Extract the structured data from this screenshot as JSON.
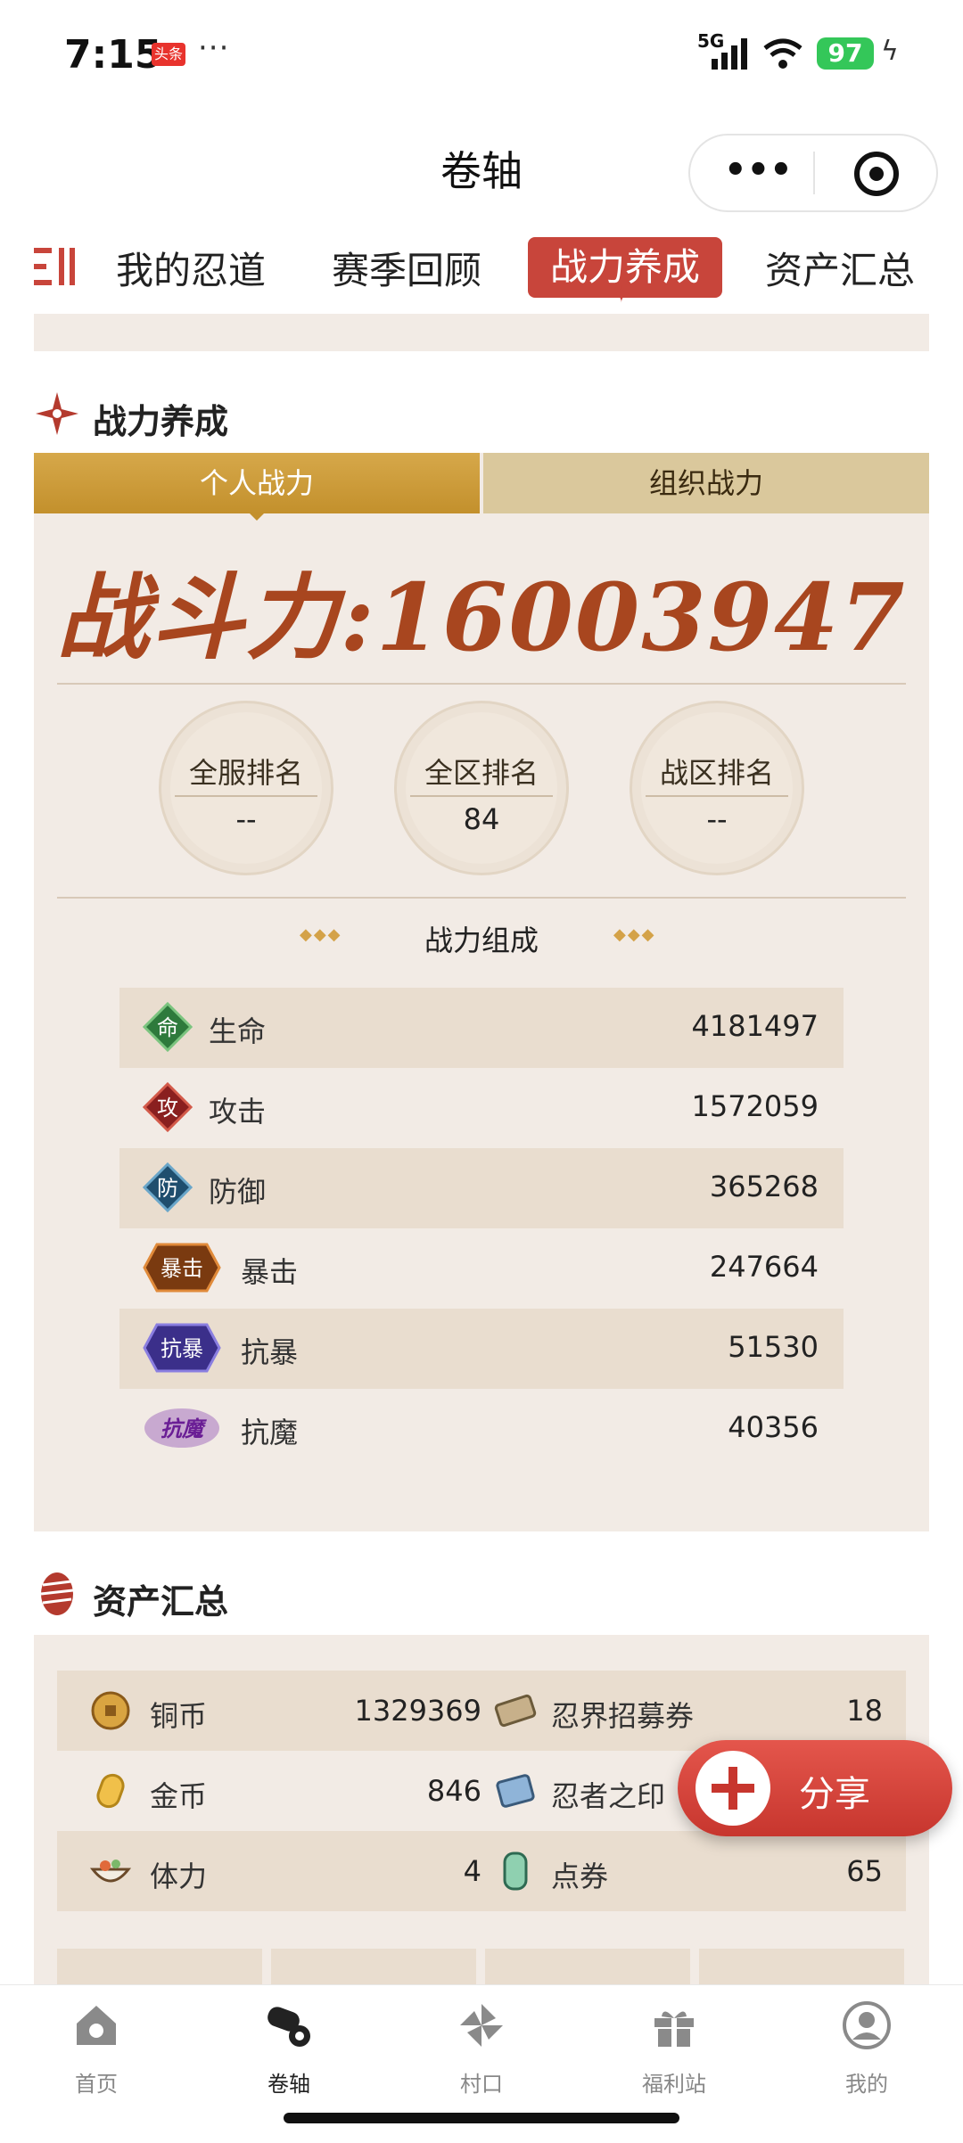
{
  "status_bar": {
    "time": "7:15",
    "badge": "头条",
    "dots": "···",
    "network": "5G",
    "battery": "97"
  },
  "header": {
    "title": "卷轴",
    "more_icon": "•••",
    "target_icon": "target-icon"
  },
  "tabs": [
    {
      "label": "我的忍道"
    },
    {
      "label": "赛季回顾"
    },
    {
      "label": "战力养成"
    },
    {
      "label": "资产汇总"
    }
  ],
  "power_section": {
    "title": "战力养成",
    "segments": {
      "personal": "个人战力",
      "org": "组织战力"
    },
    "power_text": "战斗力:16003947",
    "ranks": [
      {
        "label": "全服排名",
        "value": "--"
      },
      {
        "label": "全区排名",
        "value": "84"
      },
      {
        "label": "战区排名",
        "value": "--"
      }
    ],
    "composition_title": "战力组成",
    "stats": [
      {
        "icon_text": "命",
        "label": "生命",
        "value": "4181497"
      },
      {
        "icon_text": "攻",
        "label": "攻击",
        "value": "1572059"
      },
      {
        "icon_text": "防",
        "label": "防御",
        "value": "365268"
      },
      {
        "icon_text": "暴击",
        "label": "暴击",
        "value": "247664"
      },
      {
        "icon_text": "抗暴",
        "label": "抗暴",
        "value": "51530"
      },
      {
        "icon_text": "抗魔",
        "label": "抗魔",
        "value": "40356"
      }
    ]
  },
  "asset_section": {
    "title": "资产汇总",
    "rows": [
      {
        "l_label": "铜币",
        "l_value": "1329369",
        "r_label": "忍界招募券",
        "r_value": "18"
      },
      {
        "l_label": "金币",
        "l_value": "846",
        "r_label": "忍者之印",
        "r_value": ""
      },
      {
        "l_label": "体力",
        "l_value": "4",
        "r_label": "点券",
        "r_value": "65"
      }
    ]
  },
  "share": {
    "label": "分享"
  },
  "bottom_nav": [
    {
      "label": "首页"
    },
    {
      "label": "卷轴"
    },
    {
      "label": "村口"
    },
    {
      "label": "福利站"
    },
    {
      "label": "我的"
    }
  ]
}
